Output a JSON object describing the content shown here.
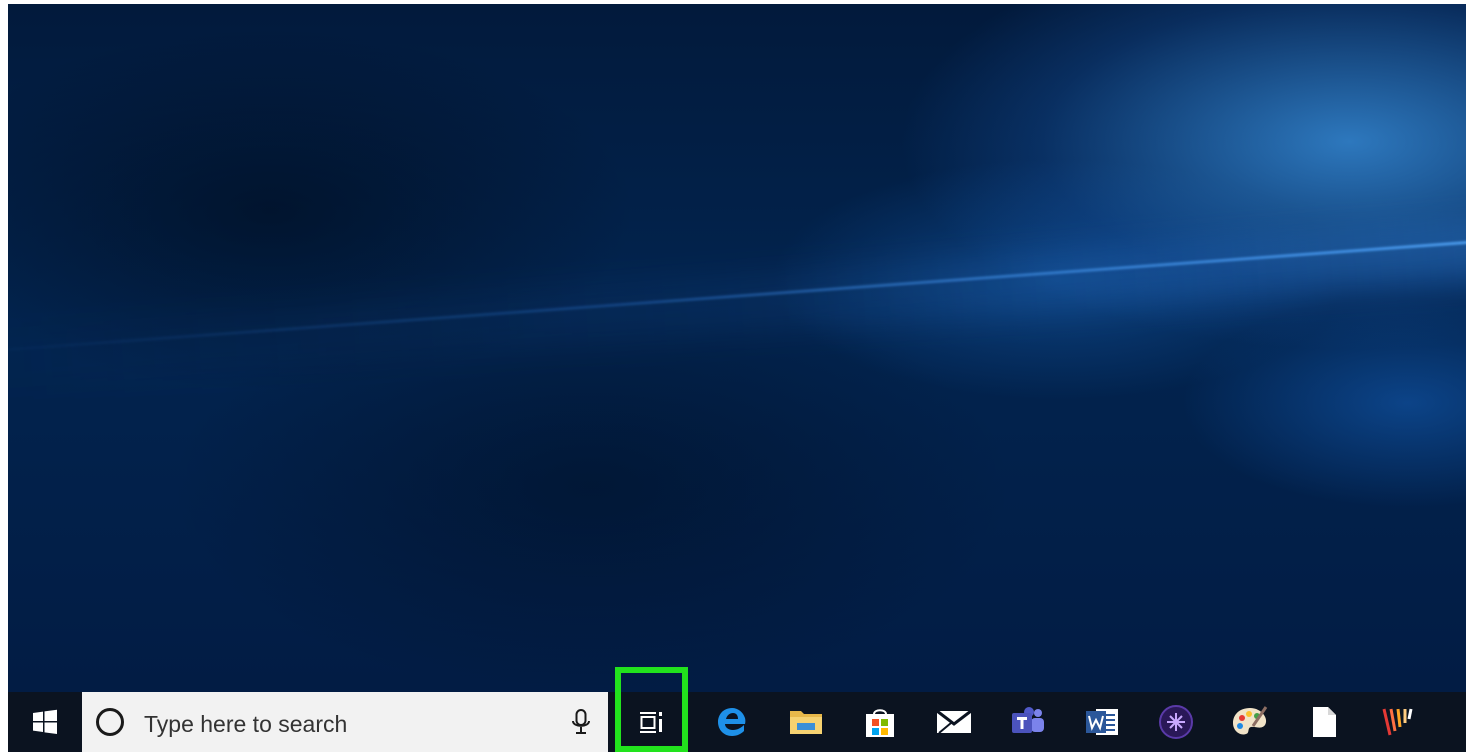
{
  "search": {
    "placeholder": "Type here to search"
  },
  "taskbar": {
    "pinned_apps": [
      {
        "name": "Microsoft Edge",
        "icon": "edge-icon"
      },
      {
        "name": "File Explorer",
        "icon": "folder-icon"
      },
      {
        "name": "Microsoft Store",
        "icon": "store-icon"
      },
      {
        "name": "Mail",
        "icon": "mail-icon"
      },
      {
        "name": "Microsoft Teams",
        "icon": "teams-icon"
      },
      {
        "name": "Microsoft Word",
        "icon": "word-icon"
      },
      {
        "name": "Purple app",
        "icon": "purple-app-icon"
      },
      {
        "name": "Paint",
        "icon": "paint-palette-icon"
      },
      {
        "name": "Document",
        "icon": "blank-document-icon"
      },
      {
        "name": "Striped app",
        "icon": "striped-app-icon"
      }
    ]
  },
  "highlight": {
    "target": "task-view-button",
    "color": "#22e31d"
  },
  "colors": {
    "taskbar_background": "#0b1320",
    "search_background": "#f2f2f2",
    "desktop_accent": "#0a5fc4"
  }
}
